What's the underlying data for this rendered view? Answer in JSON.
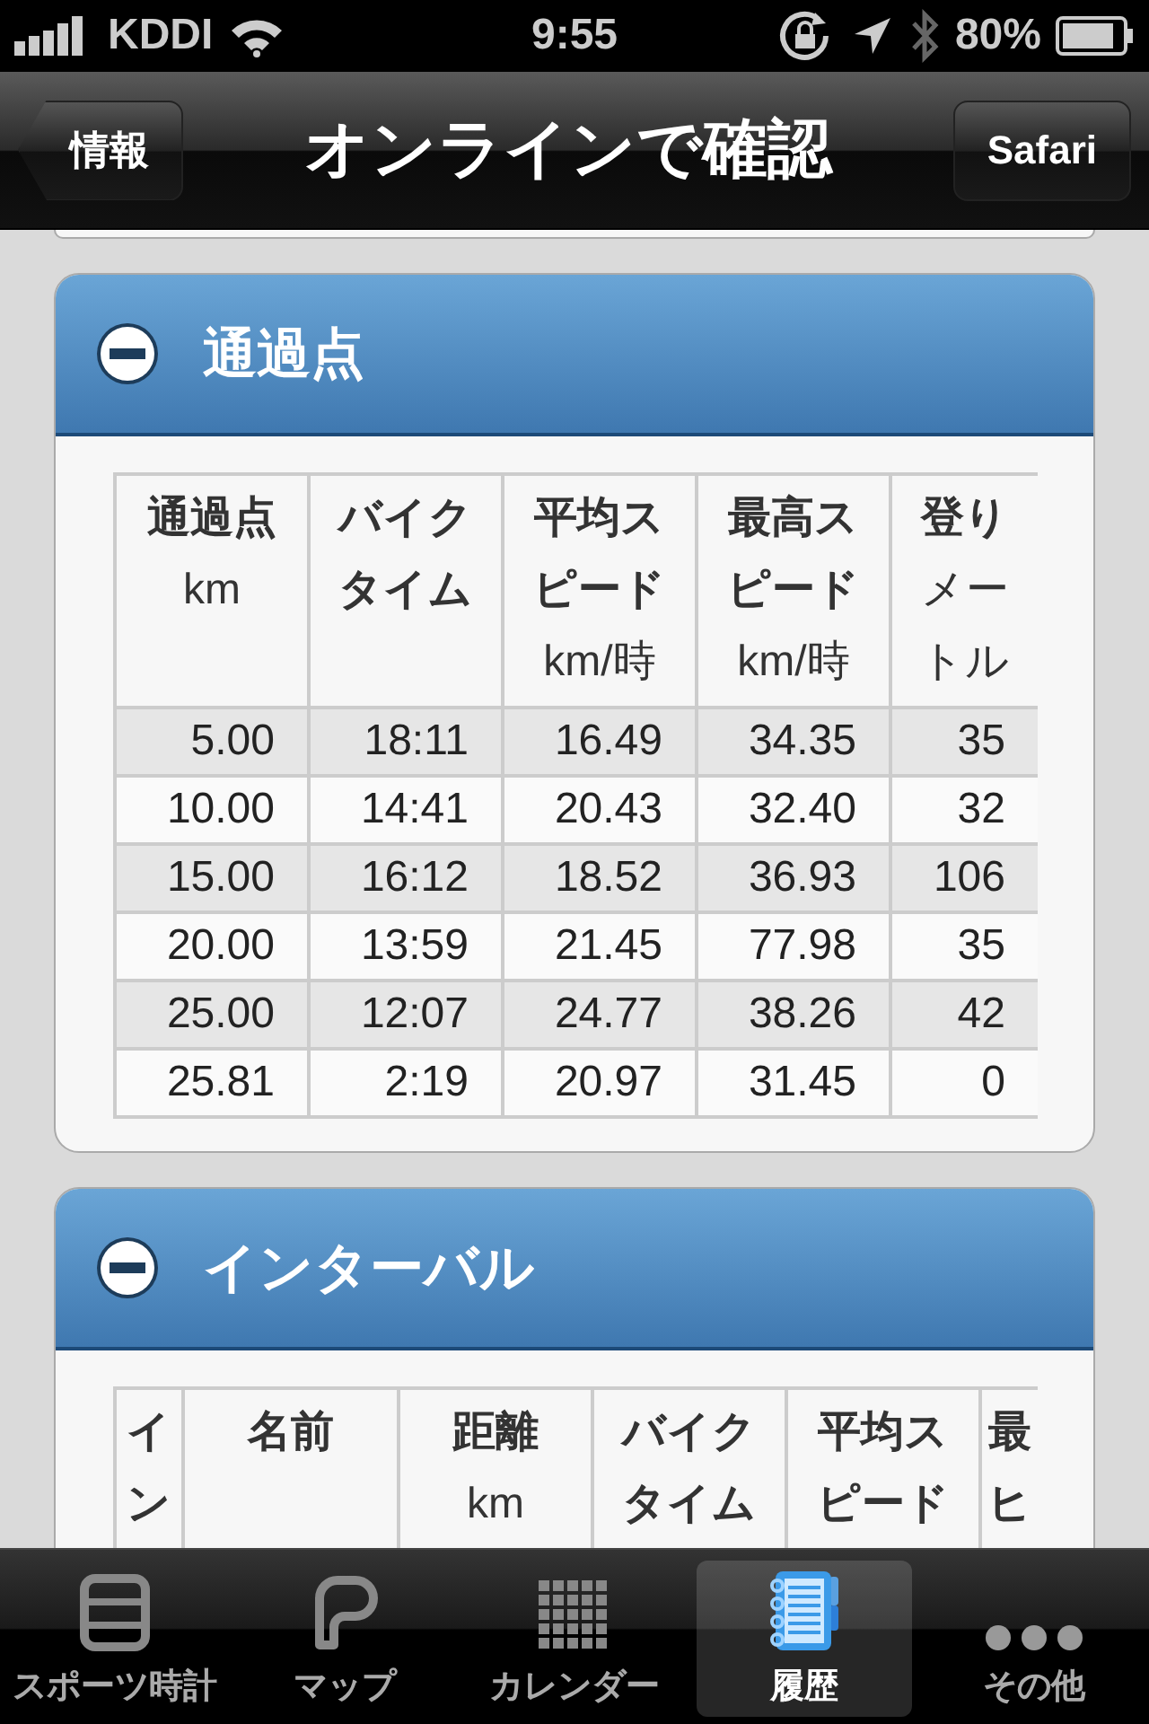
{
  "status_bar": {
    "carrier": "KDDI",
    "time": "9:55",
    "battery": "80%"
  },
  "nav_bar": {
    "back": "情報",
    "title": "オンラインで確認",
    "action": "Safari"
  },
  "sections": [
    {
      "title": "通過点",
      "expanded": true,
      "columns": [
        {
          "title_lines": [
            "通過点"
          ],
          "unit_lines": [
            "km"
          ]
        },
        {
          "title_lines": [
            "バイク",
            "タイム"
          ]
        },
        {
          "title_lines": [
            "平均ス",
            "ピード"
          ],
          "unit_lines": [
            "km/時"
          ]
        },
        {
          "title_lines": [
            "最高ス",
            "ピード"
          ],
          "unit_lines": [
            "km/時"
          ]
        },
        {
          "title_lines": [
            "登り"
          ],
          "unit_lines": [
            "メー",
            "トル"
          ]
        }
      ],
      "rows": [
        [
          "5.00",
          "18:11",
          "16.49",
          "34.35",
          "35"
        ],
        [
          "10.00",
          "14:41",
          "20.43",
          "32.40",
          "32"
        ],
        [
          "15.00",
          "16:12",
          "18.52",
          "36.93",
          "106"
        ],
        [
          "20.00",
          "13:59",
          "21.45",
          "77.98",
          "35"
        ],
        [
          "25.00",
          "12:07",
          "24.77",
          "38.26",
          "42"
        ],
        [
          "25.81",
          "2:19",
          "20.97",
          "31.45",
          "0"
        ]
      ]
    },
    {
      "title": "インターバル",
      "expanded": true,
      "columns": [
        {
          "title_lines": [
            "イ",
            "ン"
          ]
        },
        {
          "title_lines": [
            "名前"
          ]
        },
        {
          "title_lines": [
            "距離"
          ],
          "unit_lines": [
            "km"
          ]
        },
        {
          "title_lines": [
            "バイク",
            "タイム"
          ]
        },
        {
          "title_lines": [
            "平均ス",
            "ピード"
          ]
        },
        {
          "title_lines": [
            "最",
            "ヒ"
          ]
        }
      ]
    }
  ],
  "tab_bar": [
    {
      "label": "スポーツ時計",
      "selected": false
    },
    {
      "label": "マップ",
      "selected": false
    },
    {
      "label": "カレンダー",
      "selected": false
    },
    {
      "label": "履歴",
      "selected": true
    },
    {
      "label": "その他",
      "selected": false
    }
  ]
}
